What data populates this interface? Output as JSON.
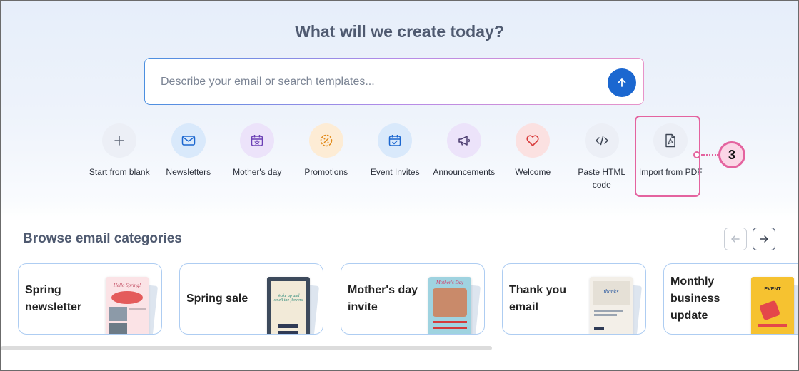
{
  "heading": "What will we create today?",
  "search": {
    "placeholder": "Describe your email or search templates..."
  },
  "actions": [
    {
      "label": "Start from blank",
      "icon": "plus-icon",
      "bg": "#eceff6",
      "color": "#5d6575"
    },
    {
      "label": "Newsletters",
      "icon": "envelope-icon",
      "bg": "#d9e9fb",
      "color": "#1b67d0"
    },
    {
      "label": "Mother's day",
      "icon": "calendar-star-icon",
      "bg": "#ece3fa",
      "color": "#6b3fb5"
    },
    {
      "label": "Promotions",
      "icon": "discount-badge-icon",
      "bg": "#fdecd5",
      "color": "#e18a1a"
    },
    {
      "label": "Event Invites",
      "icon": "calendar-check-icon",
      "bg": "#d9e9fb",
      "color": "#1b67d0"
    },
    {
      "label": "Announcements",
      "icon": "megaphone-icon",
      "bg": "#ece3fa",
      "color": "#4a3b6e"
    },
    {
      "label": "Welcome",
      "icon": "heart-icon",
      "bg": "#fbe1e1",
      "color": "#d83a3a"
    },
    {
      "label": "Paste HTML code",
      "icon": "code-icon",
      "bg": "#eceff6",
      "color": "#3d4553"
    },
    {
      "label": "Import from PDF",
      "icon": "pdf-file-icon",
      "bg": "#eceff6",
      "color": "#3d4553"
    }
  ],
  "callout": {
    "number": "3"
  },
  "browse": {
    "title": "Browse email categories",
    "cards": [
      {
        "title": "Spring newsletter"
      },
      {
        "title": "Spring sale"
      },
      {
        "title": "Mother's day invite"
      },
      {
        "title": "Thank you email"
      },
      {
        "title": "Monthly business update"
      }
    ],
    "thumbs": {
      "spring_newsletter_text": "Hello Spring!",
      "spring_sale_text": "Wake up and smell the flowers",
      "mothers_day_text": "Mother's Day",
      "thank_you_text": "thanks",
      "monthly_text": "EVENT"
    }
  }
}
